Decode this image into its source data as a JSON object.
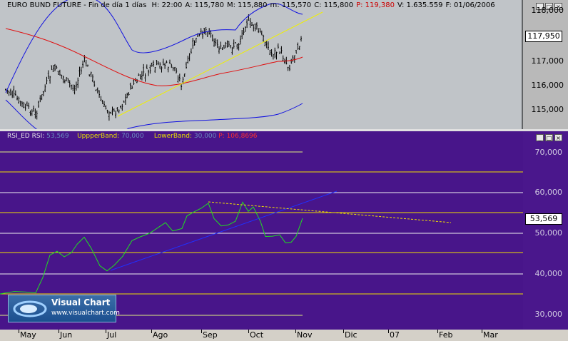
{
  "price": {
    "title": "EURO BUND FUTURE - Fin de día 1 días",
    "fields": [
      {
        "label": "H: 22:00",
        "color": "#000000"
      },
      {
        "label": "A: 115,780",
        "color": "#000000"
      },
      {
        "label": "M: 115,880",
        "color": "#000000"
      },
      {
        "label": "m: 115,570",
        "color": "#000000"
      },
      {
        "label": "C: 115,800",
        "color": "#000000"
      },
      {
        "label": "P: 119,380",
        "color": "#cc0000"
      },
      {
        "label": "V: 1.635.559",
        "color": "#000000"
      },
      {
        "label": "F: 01/06/2006",
        "color": "#000000"
      }
    ],
    "y_ticks": [
      "118,000",
      "117,000",
      "116,000",
      "115,000"
    ],
    "top_tick": "118,000",
    "current_price": "117,950"
  },
  "rsi": {
    "title": "RSI_ED  RSI:",
    "rsi_value": "53,569",
    "upper_label": "UppperBand:",
    "upper_value": "70,000",
    "lower_label": "LowerBand:",
    "lower_value": "30,000",
    "p_label": "P: 106,8696",
    "y_ticks": [
      "70,000",
      "60,000",
      "50,000",
      "40,000",
      "30,000"
    ],
    "current_value": "53,569"
  },
  "dates": [
    "May",
    "Jun",
    "Jul",
    "Ago",
    "Sep",
    "Oct",
    "Nov",
    "Dic",
    "07",
    "Feb",
    "Mar"
  ],
  "logo": {
    "title": "Visual Chart",
    "url": "www.visualchart.com"
  },
  "window_buttons": {
    "minimize": "_",
    "maximize": "□",
    "close": "×"
  }
}
